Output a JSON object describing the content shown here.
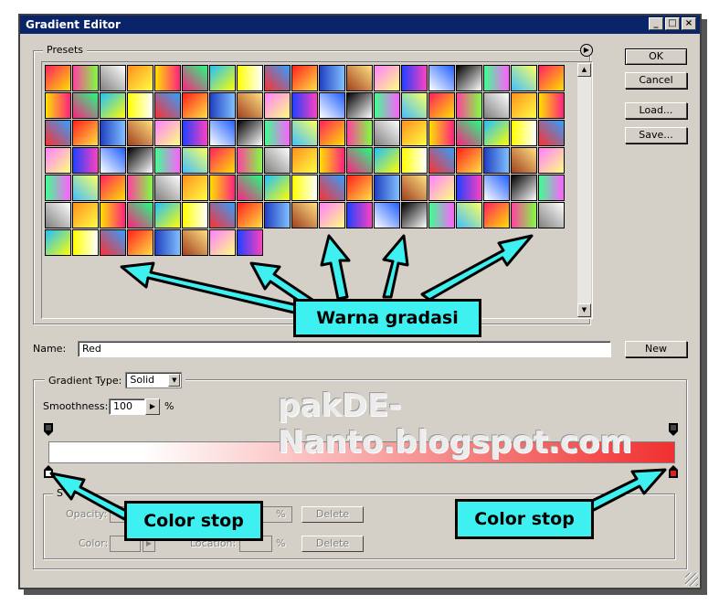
{
  "window": {
    "title": "Gradient Editor",
    "title_buttons": [
      "_",
      "□",
      "×"
    ]
  },
  "presets": {
    "title": "Presets",
    "menu_icon": "right-arrow-circle-icon"
  },
  "buttons": {
    "ok": "OK",
    "cancel": "Cancel",
    "load": "Load...",
    "save": "Save...",
    "new": "New"
  },
  "name": {
    "label": "Name:",
    "value": "Red"
  },
  "gradient_type": {
    "label": "Gradient Type:",
    "value": "Solid"
  },
  "smoothness": {
    "label": "Smoothness:",
    "value": "100",
    "unit": "%"
  },
  "stops": {
    "group_label_partial": "S",
    "opacity_label": "Opacity:",
    "color_label": "Color:",
    "location_label": "Location:",
    "percent": "%",
    "delete": "Delete"
  },
  "gradient": {
    "start_color": "#ffffff",
    "end_color": "#f03030"
  },
  "annotations": {
    "watermark": "pakDE-Nanto.blogspot.com",
    "warna_gradasi": "Warna gradasi",
    "color_stop_left": "Color stop",
    "color_stop_right": "Color stop"
  },
  "colors": {
    "callout_bg": "#3ff0f0",
    "dialog_bg": "#d4d0c8",
    "titlebar": "#0a246a"
  }
}
